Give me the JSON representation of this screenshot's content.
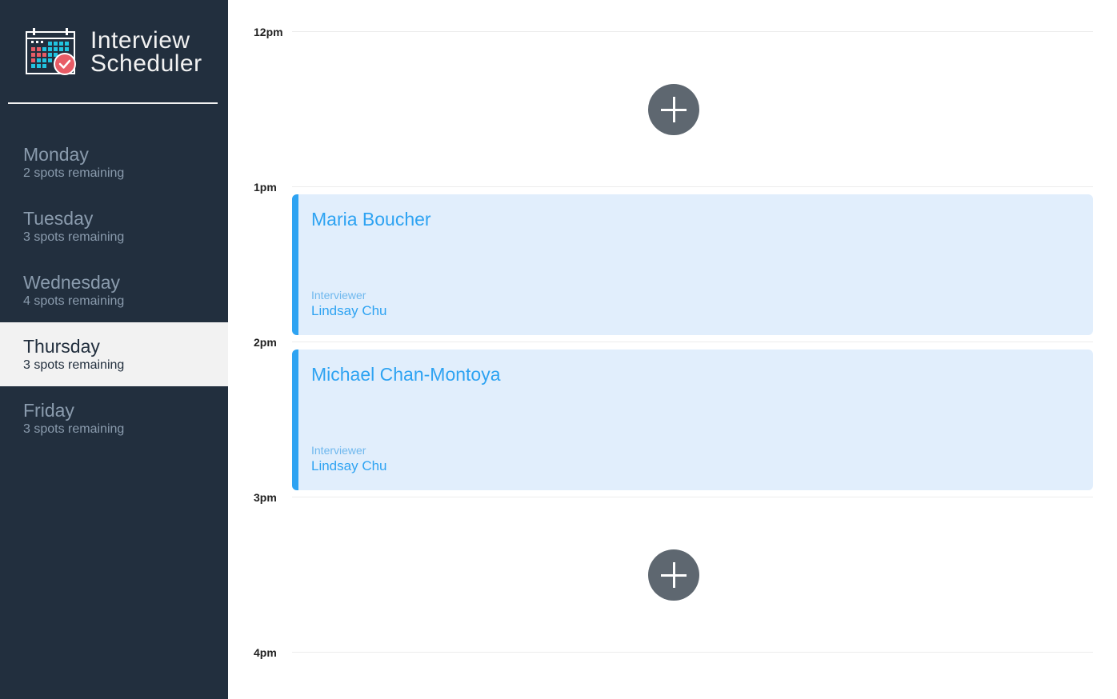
{
  "app": {
    "title_line1": "Interview",
    "title_line2": "Scheduler"
  },
  "days": [
    {
      "name": "Monday",
      "spots": "2 spots remaining",
      "selected": false
    },
    {
      "name": "Tuesday",
      "spots": "3 spots remaining",
      "selected": false
    },
    {
      "name": "Wednesday",
      "spots": "4 spots remaining",
      "selected": false
    },
    {
      "name": "Thursday",
      "spots": "3 spots remaining",
      "selected": true
    },
    {
      "name": "Friday",
      "spots": "3 spots remaining",
      "selected": false
    }
  ],
  "times": [
    "12pm",
    "1pm",
    "2pm",
    "3pm",
    "4pm"
  ],
  "appointments": [
    {
      "student": "Maria Boucher",
      "interviewer_label": "Interviewer",
      "interviewer": "Lindsay Chu"
    },
    {
      "student": "Michael Chan-Montoya",
      "interviewer_label": "Interviewer",
      "interviewer": "Lindsay Chu"
    }
  ],
  "icons": {
    "logo": "calendar-check-icon",
    "add": "plus-icon"
  },
  "colors": {
    "sidebar_bg": "#222f3e",
    "selected_bg": "#f2f2f2",
    "accent": "#2ea3f2",
    "appointment_bg": "#e1eefc",
    "add_button": "#5e6770"
  }
}
